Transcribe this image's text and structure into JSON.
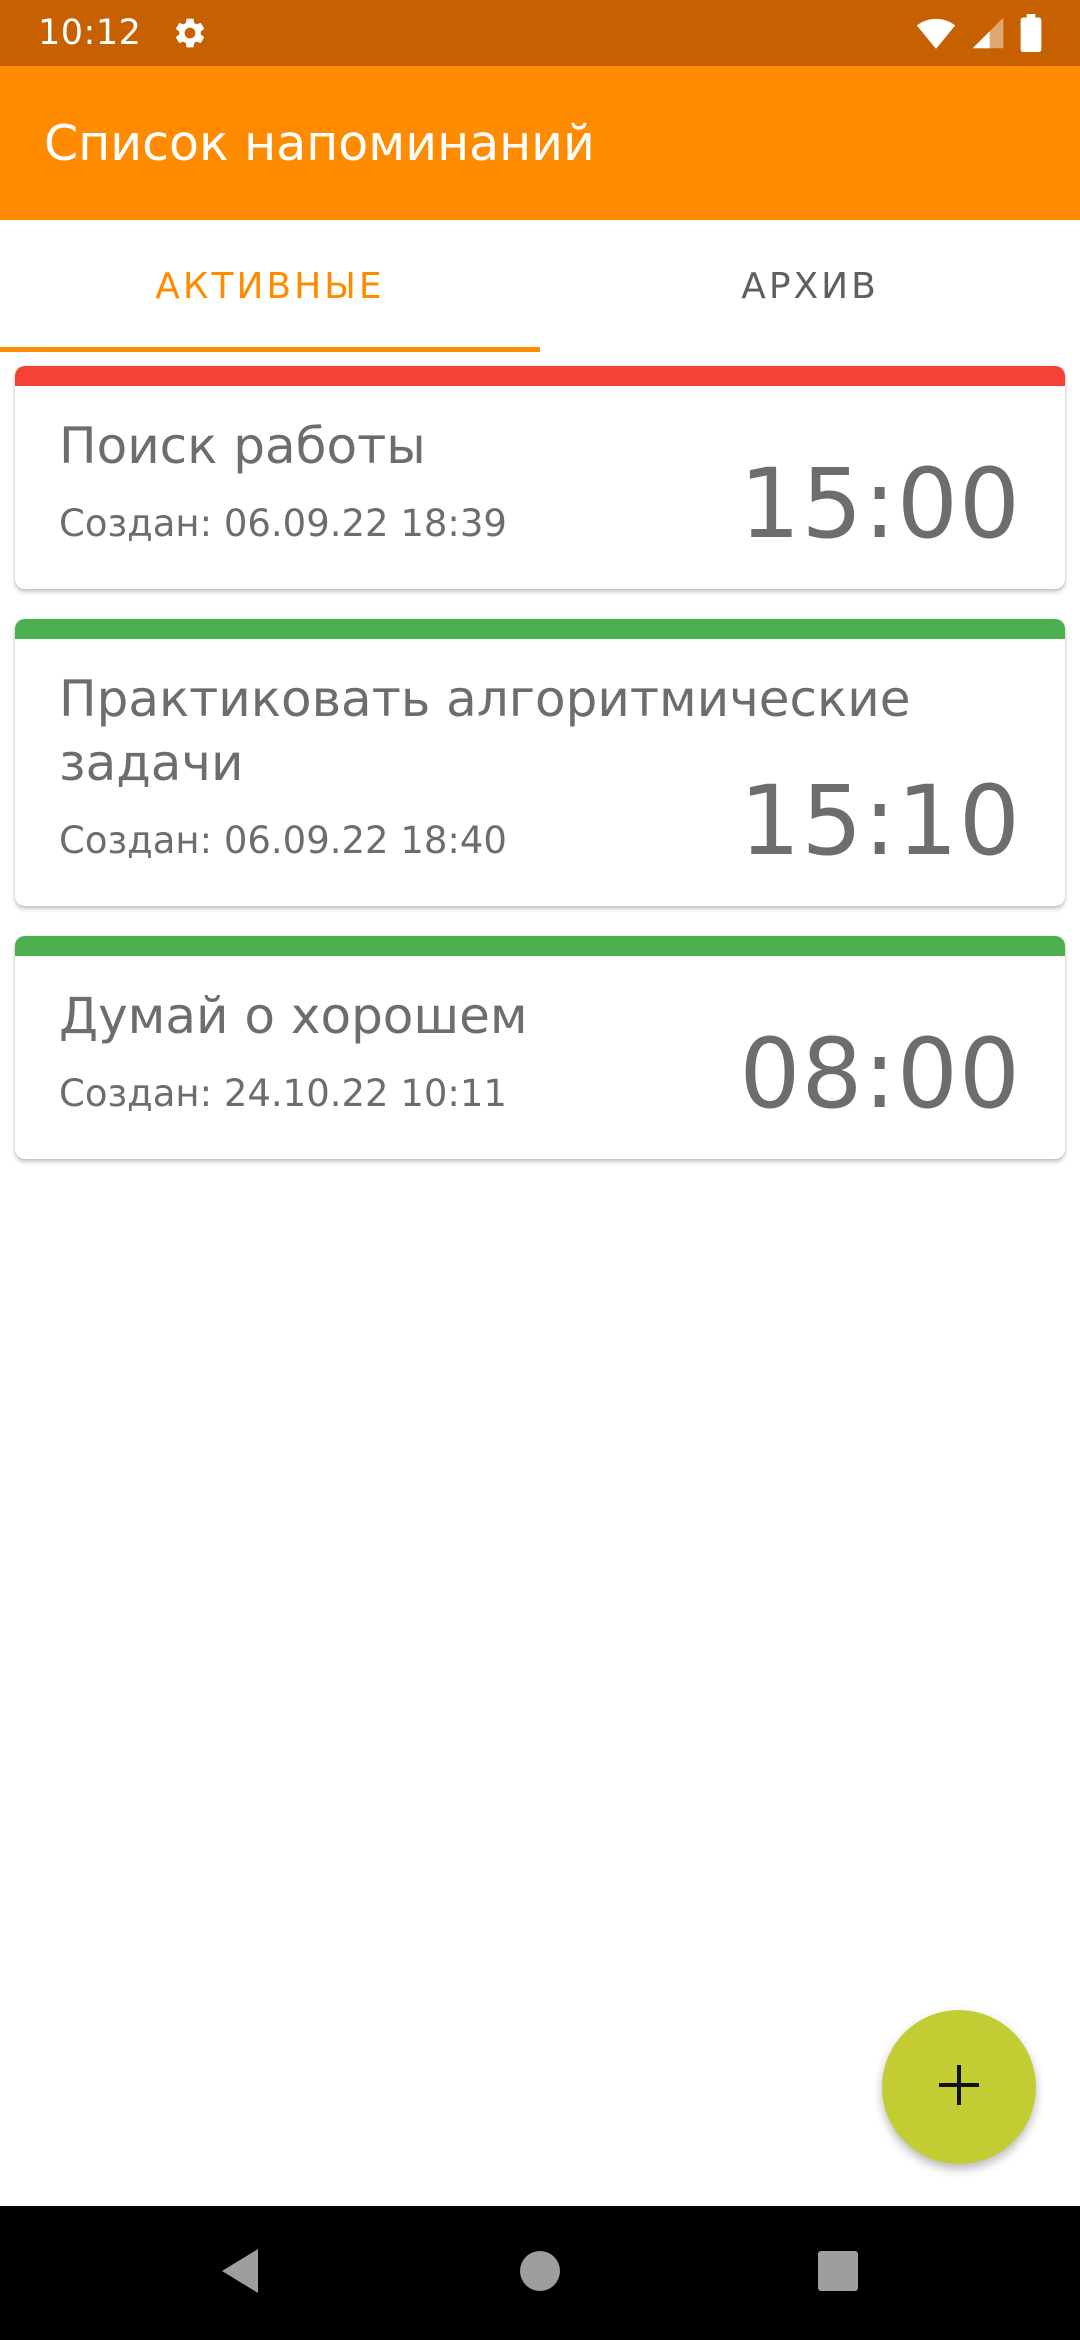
{
  "status_bar": {
    "time": "10:12",
    "icons": [
      "gear-icon",
      "wifi-icon",
      "signal-icon",
      "battery-icon"
    ]
  },
  "app_bar": {
    "title": "Список напоминаний",
    "color": "#ff8c00"
  },
  "tabs": [
    {
      "label": "АКТИВНЫЕ",
      "active": true
    },
    {
      "label": "АРХИВ",
      "active": false
    }
  ],
  "reminders": [
    {
      "title": "Поиск работы",
      "created": "Создан: 06.09.22 18:39",
      "time": "15:00",
      "color": "#f44336"
    },
    {
      "title": "Практиковать алгоритмические задачи",
      "created": "Создан: 06.09.22 18:40",
      "time": "15:10",
      "color": "#4caf50"
    },
    {
      "title": "Думай о хорошем",
      "created": "Создан: 24.10.22 10:11",
      "time": "08:00",
      "color": "#4caf50"
    }
  ],
  "fab": {
    "icon": "plus-icon",
    "color": "#c3cd33"
  },
  "nav_bar": {
    "icons": [
      "back-icon",
      "home-icon",
      "recents-icon"
    ]
  }
}
